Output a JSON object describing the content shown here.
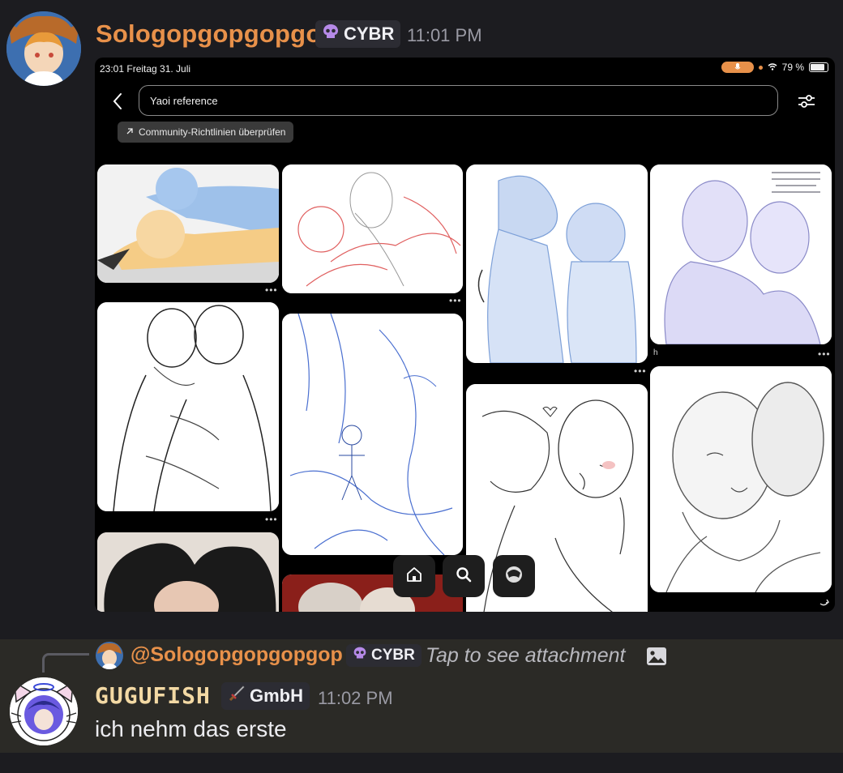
{
  "message1": {
    "username": "Sologopgopgopgop",
    "tag": "CYBR",
    "tag_icon": "skull-icon",
    "timestamp": "11:01 PM",
    "attachment": {
      "status_bar": {
        "time_date": "23:01  Freitag 31. Juli",
        "battery": "79 %"
      },
      "search": {
        "value": "Yaoi reference"
      },
      "chip": {
        "label": "Community-Richtlinien überprüfen"
      },
      "pin_captions": [
        "h"
      ],
      "nav": [
        "home-icon",
        "search-icon",
        "profile-icon"
      ]
    }
  },
  "reply": {
    "mention": "@Sologopgopgopgop",
    "tag": "CYBR",
    "text": "Tap to see attachment"
  },
  "message2": {
    "username": "GUGUFISH",
    "tag": "GmbH",
    "tag_icon": "sword-icon",
    "timestamp": "11:02 PM",
    "text": "ich nehm das erste"
  },
  "colors": {
    "background": "#1c1c20",
    "username_orange": "#e8914a",
    "username_gold": "#f3d9a4",
    "reply_highlight": "#2b2a26"
  }
}
